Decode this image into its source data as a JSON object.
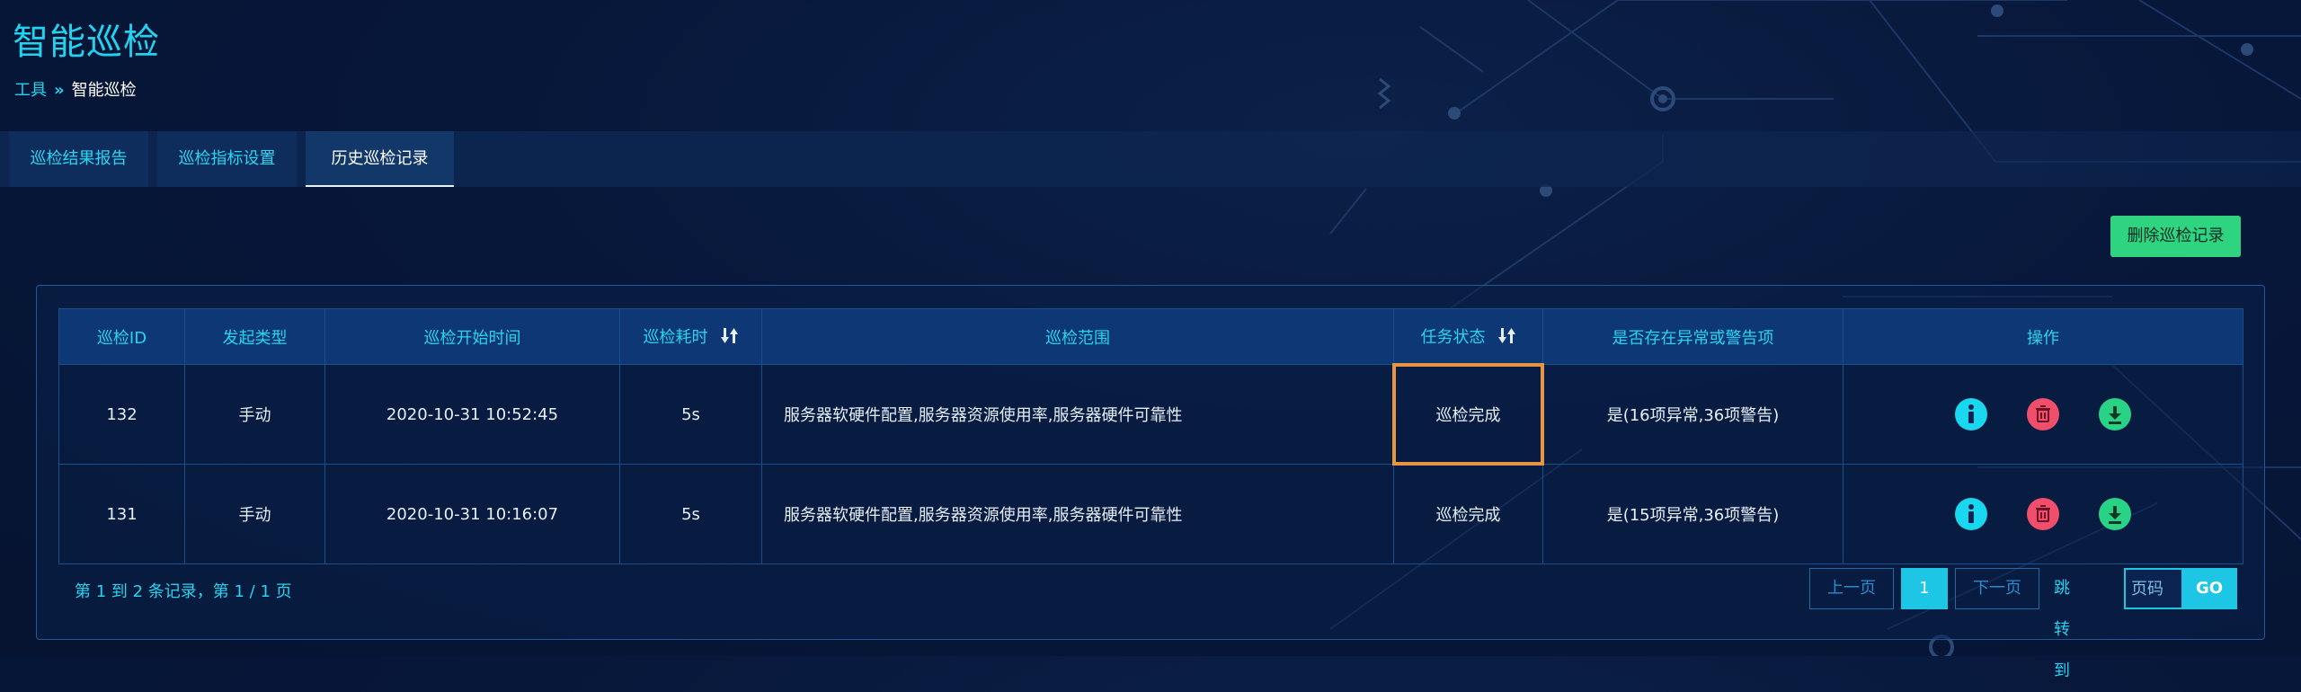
{
  "header": {
    "title": "智能巡检"
  },
  "breadcrumb": {
    "root": "工具",
    "separator": "»",
    "current": "智能巡检"
  },
  "tabs": [
    {
      "label": "巡检结果报告",
      "active": false
    },
    {
      "label": "巡检指标设置",
      "active": false
    },
    {
      "label": "历史巡检记录",
      "active": true
    }
  ],
  "toolbar": {
    "delete_label": "删除巡检记录"
  },
  "table": {
    "columns": [
      "巡检ID",
      "发起类型",
      "巡检开始时间",
      "巡检耗时",
      "巡检范围",
      "任务状态",
      "是否存在异常或警告项",
      "操作"
    ],
    "sortable_columns": [
      "巡检耗时",
      "任务状态"
    ],
    "rows": [
      {
        "id": "132",
        "type": "手动",
        "start": "2020-10-31 10:52:45",
        "duration": "5s",
        "scope": "服务器软硬件配置,服务器资源使用率,服务器硬件可靠性",
        "status": "巡检完成",
        "issues": "是(16项异常,36项警告)",
        "highlighted": true
      },
      {
        "id": "131",
        "type": "手动",
        "start": "2020-10-31 10:16:07",
        "duration": "5s",
        "scope": "服务器软硬件配置,服务器资源使用率,服务器硬件可靠性",
        "status": "巡检完成",
        "issues": "是(15项异常,36项警告)",
        "highlighted": false
      }
    ],
    "row_actions": [
      "info-icon",
      "trash-icon",
      "download-icon"
    ]
  },
  "pagination": {
    "summary": "第 1 到 2 条记录，第 1 / 1 页",
    "prev_label": "上一页",
    "current_page": "1",
    "next_label": "下一页",
    "jump_label": "跳转到",
    "page_placeholder": "页码",
    "go_label": "GO"
  },
  "colors": {
    "accent": "#22d3f0",
    "delete_button": "#2fd480",
    "info_icon": "#19d7ee",
    "trash_icon": "#ef4f6a",
    "download_icon": "#29d386",
    "highlight_border": "#e79443"
  }
}
